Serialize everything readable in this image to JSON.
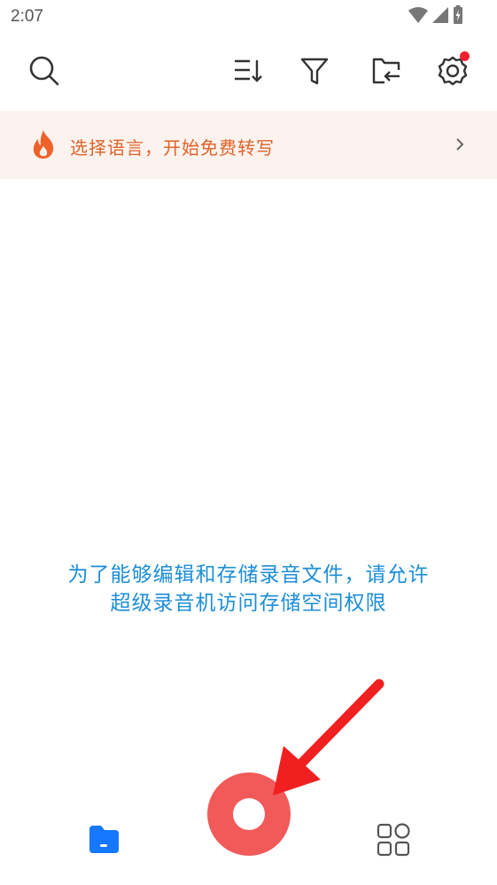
{
  "status_bar": {
    "time": "2:07"
  },
  "toolbar": {
    "icons": [
      "search-icon",
      "sort-icon",
      "filter-icon",
      "folder-import-icon",
      "settings-icon"
    ],
    "settings_has_notification": true
  },
  "banner": {
    "text": "选择语言，开始免费转写",
    "icon": "fire-icon",
    "color": "#e0622a",
    "background": "#fdf3ee"
  },
  "permission_message": {
    "line1": "为了能够编辑和存储录音文件，请允许",
    "line2": "超级录音机访问存储空间权限",
    "color": "#1d8ed8"
  },
  "bottom_nav": {
    "left_icon": "folder-files-icon",
    "center": "record-button",
    "right_icon": "apps-grid-icon",
    "accent": "#1677ff",
    "record_color": "#f25a5a"
  },
  "annotation": {
    "arrow_color": "#f02020"
  }
}
